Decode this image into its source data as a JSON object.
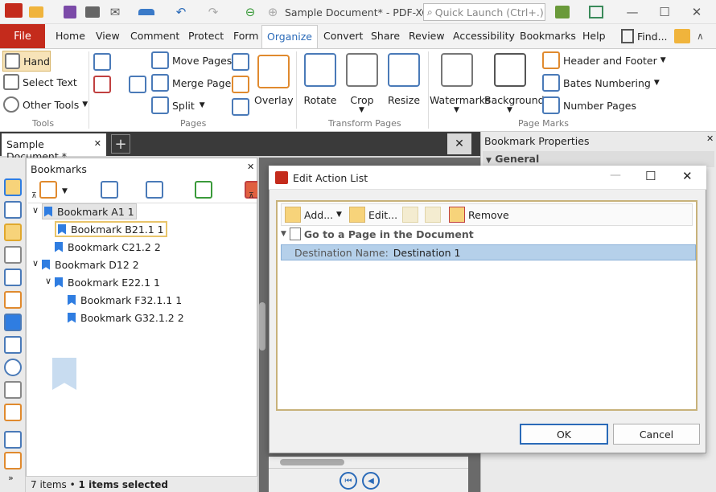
{
  "window": {
    "title": "Sample Document* - PDF-XCh...",
    "quick_launch_placeholder": "Quick Launch (Ctrl+.)",
    "minimize": "—",
    "maximize": "☐",
    "close": "✕"
  },
  "menu_tabs": [
    "File",
    "Home",
    "View",
    "Comment",
    "Protect",
    "Form",
    "Organize",
    "Convert",
    "Share",
    "Review",
    "Accessibility",
    "Bookmarks",
    "Help"
  ],
  "find_label": "Find...",
  "ribbon": {
    "tools": {
      "hand": "Hand",
      "select_text": "Select Text",
      "other_tools": "Other Tools",
      "group": "Tools"
    },
    "pages": {
      "move": "Move Pages",
      "merge": "Merge Pages",
      "split": "Split",
      "overlay": "Overlay",
      "group": "Pages"
    },
    "transform": {
      "rotate": "Rotate",
      "crop": "Crop",
      "resize": "Resize",
      "group": "Transform Pages"
    },
    "marks": {
      "watermarks": "Watermarks",
      "background": "Background",
      "header_footer": "Header and Footer",
      "bates": "Bates Numbering",
      "page_numbers": "Number Pages",
      "group": "Page Marks"
    }
  },
  "doc_tab": "Sample Document *",
  "bookmarks": {
    "title": "Bookmarks",
    "items": [
      {
        "label": "Bookmark A1 1",
        "level": 0,
        "expander": "∨"
      },
      {
        "label": "Bookmark B21.1 1",
        "level": 1,
        "expander": ""
      },
      {
        "label": "Bookmark C21.2 2",
        "level": 1,
        "expander": ""
      },
      {
        "label": "Bookmark D12 2",
        "level": 0,
        "expander": "∨"
      },
      {
        "label": "Bookmark E22.1 1",
        "level": 1,
        "expander": "∨"
      },
      {
        "label": "Bookmark F32.1.1 1",
        "level": 2,
        "expander": ""
      },
      {
        "label": "Bookmark G32.1.2 2",
        "level": 2,
        "expander": ""
      }
    ],
    "status_count": "7 items",
    "status_sel": "1 items selected"
  },
  "properties": {
    "title": "Bookmark Properties",
    "section": "General"
  },
  "dialog": {
    "title": "Edit Action List",
    "add": "Add...",
    "edit": "Edit...",
    "remove": "Remove",
    "action_header": "Go to a Page in the Document",
    "dest_label": "Destination Name:",
    "dest_value": "Destination 1",
    "ok": "OK",
    "cancel": "Cancel"
  },
  "colors": {
    "accent": "#c42b1c",
    "selection": "#b5d0ea",
    "bookmark": "#2f7de1"
  }
}
